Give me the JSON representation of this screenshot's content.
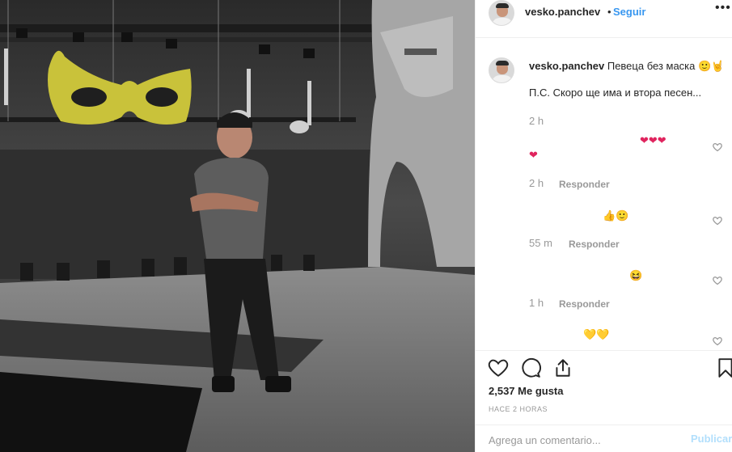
{
  "post": {
    "username": "vesko.panchev",
    "separator": "•",
    "follow_label": "Seguir",
    "more_label": "•••"
  },
  "caption": {
    "username": "vesko.panchev",
    "text": "Певеца без маска",
    "emoji": "🙂🤘",
    "line2": "П.С. Скоро ще има и втора песен...",
    "time": "2 h"
  },
  "comments": [
    {
      "emoji": "❤❤❤",
      "second_emoji": "❤",
      "time": "2 h",
      "reply_label": "Responder"
    },
    {
      "emoji": "👍🙂",
      "time": "55 m",
      "reply_label": "Responder"
    },
    {
      "emoji": "😆",
      "time": "1 h",
      "reply_label": "Responder"
    },
    {
      "emoji": "💛💛"
    }
  ],
  "actions": {
    "like_icon": "heart-outline-icon",
    "comment_icon": "comment-bubble-icon",
    "share_icon": "share-icon",
    "save_icon": "bookmark-icon"
  },
  "likes_text": "2,537 Me gusta",
  "posted_time": "HACE 2 HORAS",
  "add_comment": {
    "placeholder": "Agrega un comentario...",
    "publish_label": "Publicar"
  },
  "colors": {
    "link_blue": "#3897f0",
    "publish_disabled": "#b2dffc",
    "meta_gray": "#999999",
    "mask_yellow": "#c9c23a"
  }
}
